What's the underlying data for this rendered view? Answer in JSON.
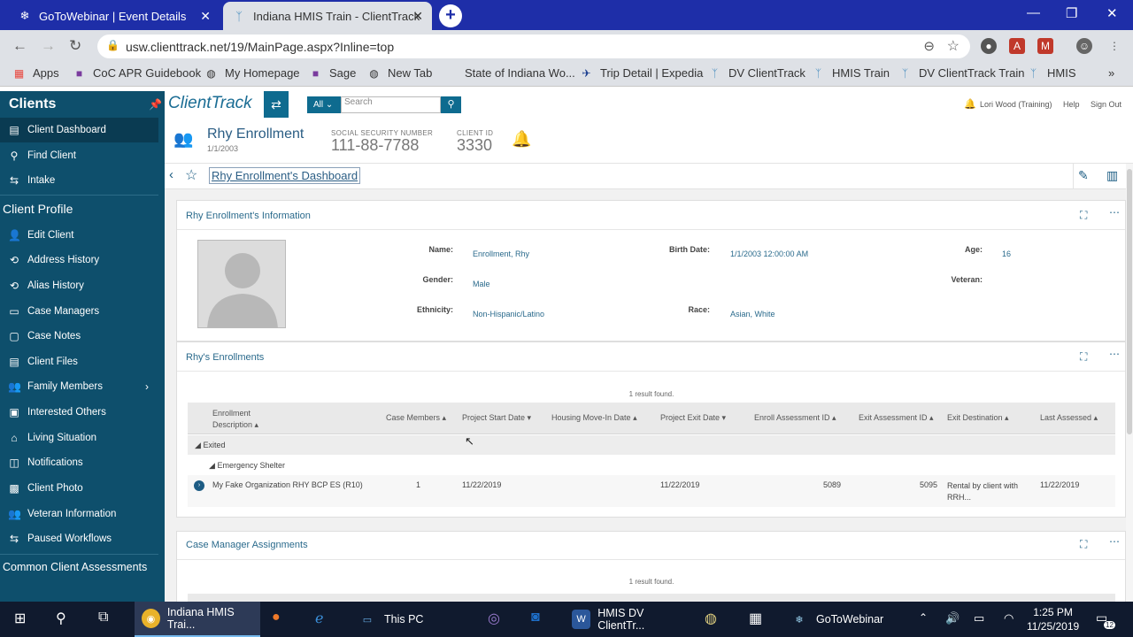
{
  "browser": {
    "tabs": [
      {
        "title": "GoToWebinar | Event Details",
        "active": false
      },
      {
        "title": "Indiana HMIS Train - ClientTrack",
        "active": true
      }
    ],
    "new_tab": "+",
    "url": "usw.clienttrack.net/19/MainPage.aspx?Inline=top",
    "bookmarks": [
      "Apps",
      "CoC APR Guidebook",
      "My Homepage",
      "Sage",
      "New Tab",
      "State of Indiana Wo...",
      "Trip Detail | Expedia",
      "DV ClientTrack",
      "HMIS Train",
      "DV ClientTrack Train",
      "HMIS"
    ]
  },
  "sidebar": {
    "clients_header": "Clients",
    "clients_items": [
      {
        "label": "Client Dashboard",
        "icon": "map-icon"
      },
      {
        "label": "Find Client",
        "icon": "search-icon"
      },
      {
        "label": "Intake",
        "icon": "workflow-icon"
      }
    ],
    "profile_header": "Client Profile",
    "profile_items": [
      {
        "label": "Edit Client",
        "icon": "user-icon"
      },
      {
        "label": "Address History",
        "icon": "history-icon"
      },
      {
        "label": "Alias History",
        "icon": "history-icon"
      },
      {
        "label": "Case Managers",
        "icon": "folder-icon"
      },
      {
        "label": "Case Notes",
        "icon": "note-icon"
      },
      {
        "label": "Client Files",
        "icon": "file-icon"
      },
      {
        "label": "Family Members",
        "icon": "family-icon"
      },
      {
        "label": "Interested Others",
        "icon": "card-icon"
      },
      {
        "label": "Living Situation",
        "icon": "home-icon"
      },
      {
        "label": "Notifications",
        "icon": "notification-icon"
      },
      {
        "label": "Client Photo",
        "icon": "photo-icon"
      },
      {
        "label": "Veteran Information",
        "icon": "veteran-icon"
      },
      {
        "label": "Paused Workflows",
        "icon": "workflow-icon"
      }
    ],
    "assessments_header": "Common Client Assessments"
  },
  "app_header": {
    "logo": "ClientTrack",
    "search_scope": "All",
    "search_placeholder": "Search",
    "user": "Lori Wood (Training)",
    "help": "Help",
    "sign_out": "Sign Out"
  },
  "client": {
    "name": "Rhy Enrollment",
    "dob": "1/1/2003",
    "ssn_label": "SOCIAL SECURITY NUMBER",
    "ssn": "111-88-7788",
    "id_label": "CLIENT ID",
    "id": "3330"
  },
  "dashboard_title": "Rhy Enrollment's Dashboard",
  "info_panel": {
    "title": "Rhy Enrollment's Information",
    "fields": {
      "name_label": "Name",
      "name": "Enrollment, Rhy",
      "birth_label": "Birth Date",
      "birth": "1/1/2003 12:00:00 AM",
      "age_label": "Age",
      "age": "16",
      "gender_label": "Gender",
      "gender": "Male",
      "veteran_label": "Veteran",
      "veteran": "",
      "ethnicity_label": "Ethnicity",
      "ethnicity": "Non-Hispanic/Latino",
      "race_label": "Race",
      "race": "Asian, White"
    }
  },
  "enrollments_panel": {
    "title": "Rhy's Enrollments",
    "result_text": "1 result found.",
    "columns": [
      "Enrollment",
      "Description",
      "Case Members",
      "Project Start Date",
      "Housing Move-In Date",
      "Project Exit Date",
      "Enroll Assessment ID",
      "Exit Assessment ID",
      "Exit Destination",
      "Last Assessed"
    ],
    "group": "Exited",
    "subgroup": "Emergency Shelter",
    "rows": [
      {
        "enrollment": "My Fake Organization RHY BCP ES (R10)",
        "case_members": "1",
        "start": "11/22/2019",
        "move_in": "",
        "exit": "11/22/2019",
        "enroll_id": "5089",
        "exit_id": "5095",
        "destination_1": "Rental by client with",
        "destination_2": "RRH...",
        "last_assessed": "11/22/2019"
      }
    ]
  },
  "case_manager_panel": {
    "title": "Case Manager Assignments",
    "result_text": "1 result found."
  },
  "taskbar": {
    "apps": [
      {
        "label": "Indiana HMIS Trai...",
        "active": true
      },
      {
        "label": "This PC",
        "active": false
      },
      {
        "label": "HMIS DV ClientTr...",
        "active": false
      },
      {
        "label": "GoToWebinar",
        "active": false
      }
    ],
    "time": "1:25 PM",
    "date": "11/25/2019",
    "notif_count": "12"
  },
  "colors": {
    "sidebar": "#0e4f6c",
    "tabstrip": "#1e2ea8",
    "accent": "#0e6b8f",
    "link": "#2a6a8c"
  }
}
